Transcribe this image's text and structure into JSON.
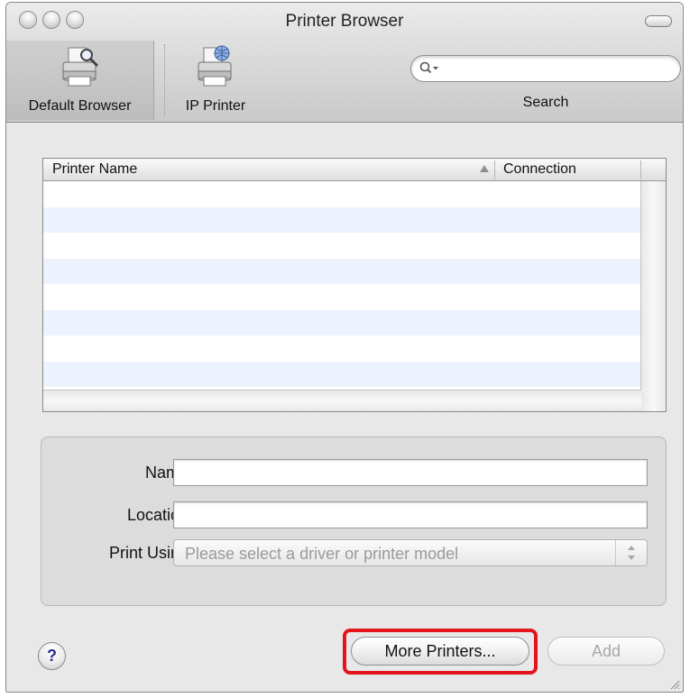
{
  "window": {
    "title": "Printer Browser"
  },
  "toolbar": {
    "items": [
      {
        "label": "Default Browser",
        "icon": "printer-search-icon",
        "selected": true
      },
      {
        "label": "IP Printer",
        "icon": "ip-printer-icon",
        "selected": false
      }
    ],
    "search": {
      "label": "Search",
      "value": "",
      "placeholder": ""
    }
  },
  "table": {
    "columns": [
      "Printer Name",
      "Connection"
    ],
    "sort_column": "Printer Name",
    "rows": []
  },
  "form": {
    "name_label": "Name:",
    "name_value": "",
    "location_label": "Location:",
    "location_value": "",
    "print_using_label": "Print Using:",
    "print_using_value": "Please select a driver or printer model"
  },
  "buttons": {
    "help": "?",
    "more_printers": "More Printers...",
    "add": "Add"
  },
  "colors": {
    "highlight": "#e3141d",
    "row_stripe": "#edf3fe",
    "disabled_text": "#a8a8a8"
  }
}
